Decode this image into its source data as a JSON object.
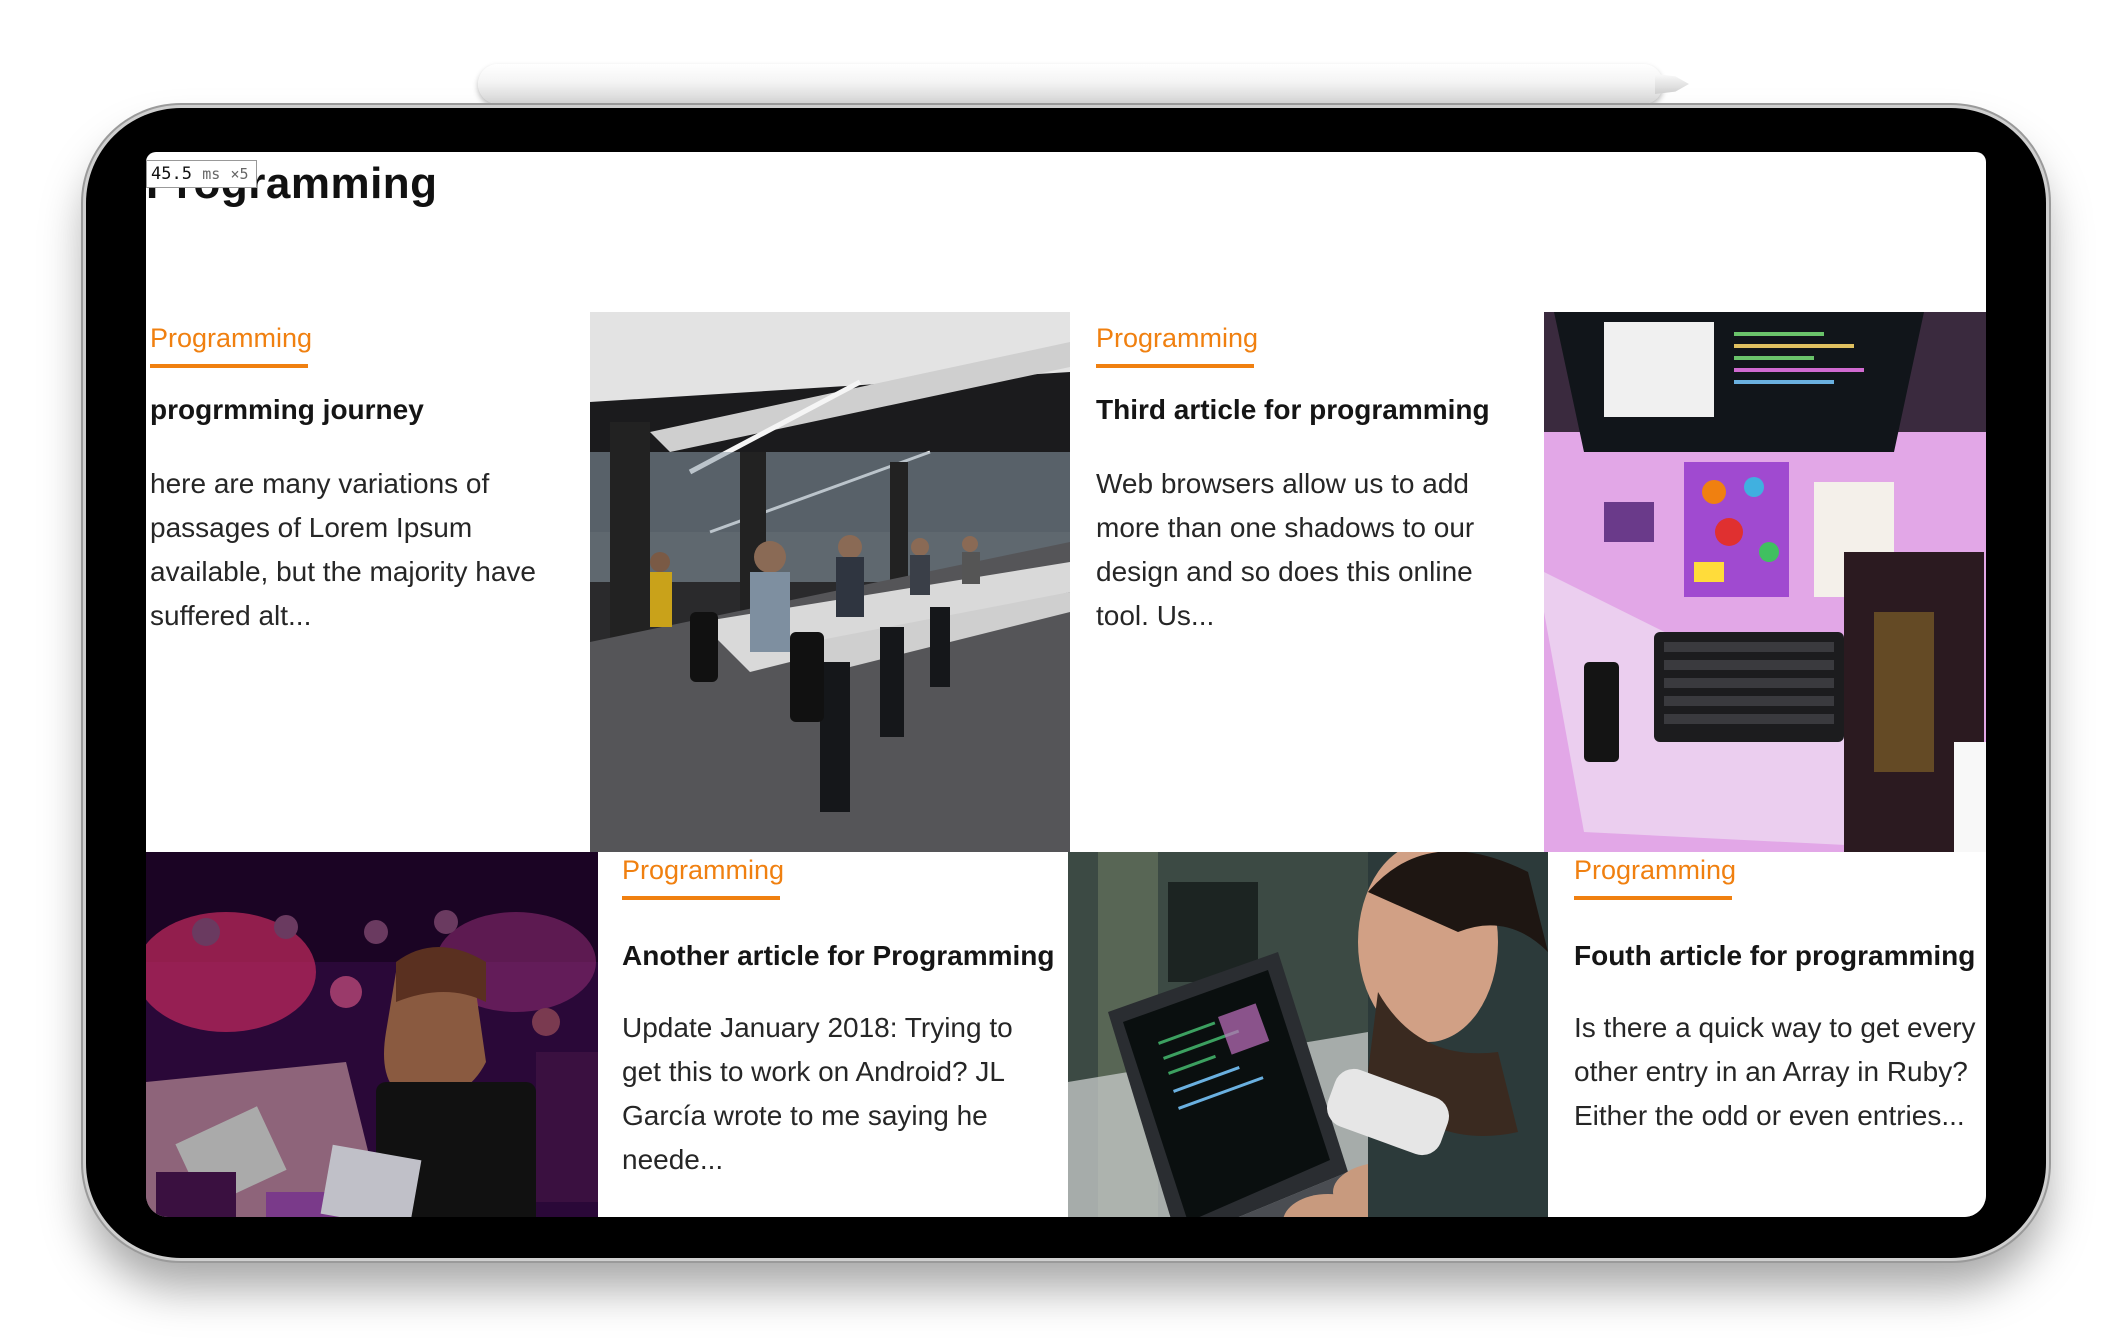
{
  "timer": {
    "value": "45.5",
    "unit": "ms",
    "multiplier": "×5"
  },
  "page": {
    "title": "Programming"
  },
  "accent_color": "#f08010",
  "articles": [
    {
      "category": "Programming",
      "title": "progrmming journey",
      "excerpt": "here are many variations of passages of Lorem Ipsum available, but the majority have suffered alt..."
    },
    {
      "category": "Programming",
      "title": "Third article for programming",
      "excerpt": "Web browsers allow us to add more than one shadows to our design and so does this online tool. Us..."
    },
    {
      "category": "Programming",
      "title": "Another article for Programming",
      "excerpt": "Update January 2018: Trying to get this to work on Android? JL García wrote to me saying he neede..."
    },
    {
      "category": "Programming",
      "title": "Fouth article for programming",
      "excerpt": "Is there a quick way to get every other entry in an Array in Ruby? Either the odd or even entries..."
    }
  ],
  "images": [
    {
      "subject": "open-plan office with rows of people coding at desks"
    },
    {
      "subject": "desk with monitor, stickered laptop and keyboard under pink light"
    },
    {
      "subject": "people with laptops at a hackathon under purple light"
    },
    {
      "subject": "man typing code on a laptop"
    }
  ]
}
